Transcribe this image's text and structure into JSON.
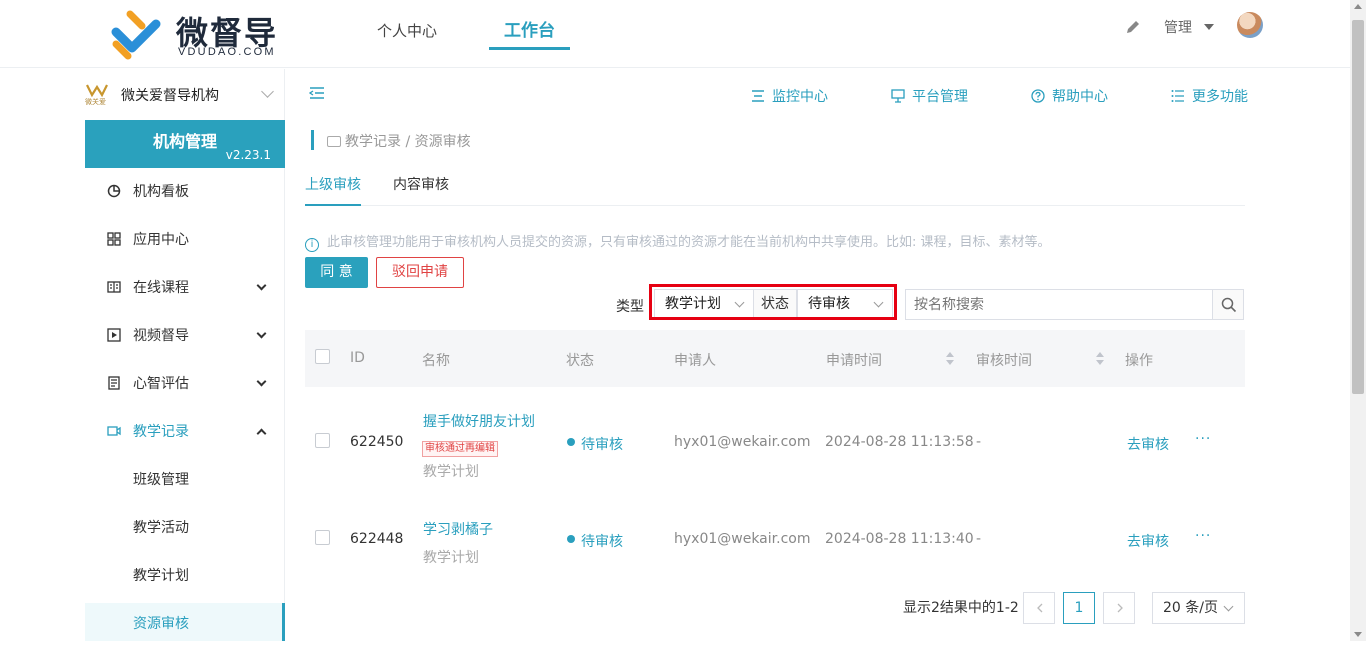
{
  "header": {
    "logo_title": "微督导",
    "logo_sub": "VDUDAO.COM",
    "nav": [
      {
        "label": "个人中心",
        "active": false
      },
      {
        "label": "工作台",
        "active": true
      }
    ],
    "user_label": "管理",
    "icons": [
      "edit-icon",
      "caret-down-icon",
      "avatar"
    ]
  },
  "sidebar": {
    "org_logo_text": "微关爱",
    "org_name": "微关爱督导机构",
    "panel_title": "机构管理",
    "version": "v2.23.1",
    "items": [
      {
        "label": "机构看板",
        "icon": "pie-chart-icon",
        "chevron": ""
      },
      {
        "label": "应用中心",
        "icon": "grid-icon",
        "chevron": ""
      },
      {
        "label": "在线课程",
        "icon": "book-icon",
        "chevron": "down"
      },
      {
        "label": "视频督导",
        "icon": "play-icon",
        "chevron": "down"
      },
      {
        "label": "心智评估",
        "icon": "clipboard-icon",
        "chevron": "down"
      },
      {
        "label": "教学记录",
        "icon": "video-icon",
        "chevron": "up",
        "open": true
      }
    ],
    "sub_items": [
      {
        "label": "班级管理",
        "active": false
      },
      {
        "label": "教学活动",
        "active": false
      },
      {
        "label": "教学计划",
        "active": false
      },
      {
        "label": "资源审核",
        "active": true
      }
    ]
  },
  "quick_links": [
    {
      "label": "监控中心",
      "icon": "monitor-icon"
    },
    {
      "label": "平台管理",
      "icon": "desktop-icon"
    },
    {
      "label": "帮助中心",
      "icon": "help-icon"
    },
    {
      "label": "更多功能",
      "icon": "list-icon"
    }
  ],
  "breadcrumb": "教学记录 / 资源审核",
  "tabs": [
    {
      "label": "上级审核",
      "active": true
    },
    {
      "label": "内容审核",
      "active": false
    }
  ],
  "notice": "此审核管理功能用于审核机构人员提交的资源，只有审核通过的资源才能在当前机构中共享使用。比如: 课程，目标、素材等。",
  "actions": {
    "approve": "同 意",
    "reject": "驳回申请"
  },
  "filters": {
    "type_label": "类型",
    "type_value": "教学计划",
    "status_label": "状态",
    "status_value": "待审核",
    "search_placeholder": "按名称搜索"
  },
  "table": {
    "columns": [
      "ID",
      "名称",
      "状态",
      "申请人",
      "申请时间",
      "审核时间",
      "操作"
    ],
    "rows": [
      {
        "id": "622450",
        "name": "握手做好朋友计划",
        "tag": "审核通过再编辑",
        "type": "教学计划",
        "status": "待审核",
        "applicant": "hyx01@wekair.com",
        "apply_time": "2024-08-28 11:13:58",
        "review_time": "-",
        "action": "去审核",
        "more": "···"
      },
      {
        "id": "622448",
        "name": "学习剥橘子",
        "tag": "",
        "type": "教学计划",
        "status": "待审核",
        "applicant": "hyx01@wekair.com",
        "apply_time": "2024-08-28 11:13:40",
        "review_time": "-",
        "action": "去审核",
        "more": "···"
      }
    ]
  },
  "pagination": {
    "summary": "显示2结果中的1-2",
    "current_page": "1",
    "page_size": "20 条/页"
  },
  "colors": {
    "accent": "#2aa1bd",
    "danger": "#e04343",
    "highlight": "#e60012"
  }
}
